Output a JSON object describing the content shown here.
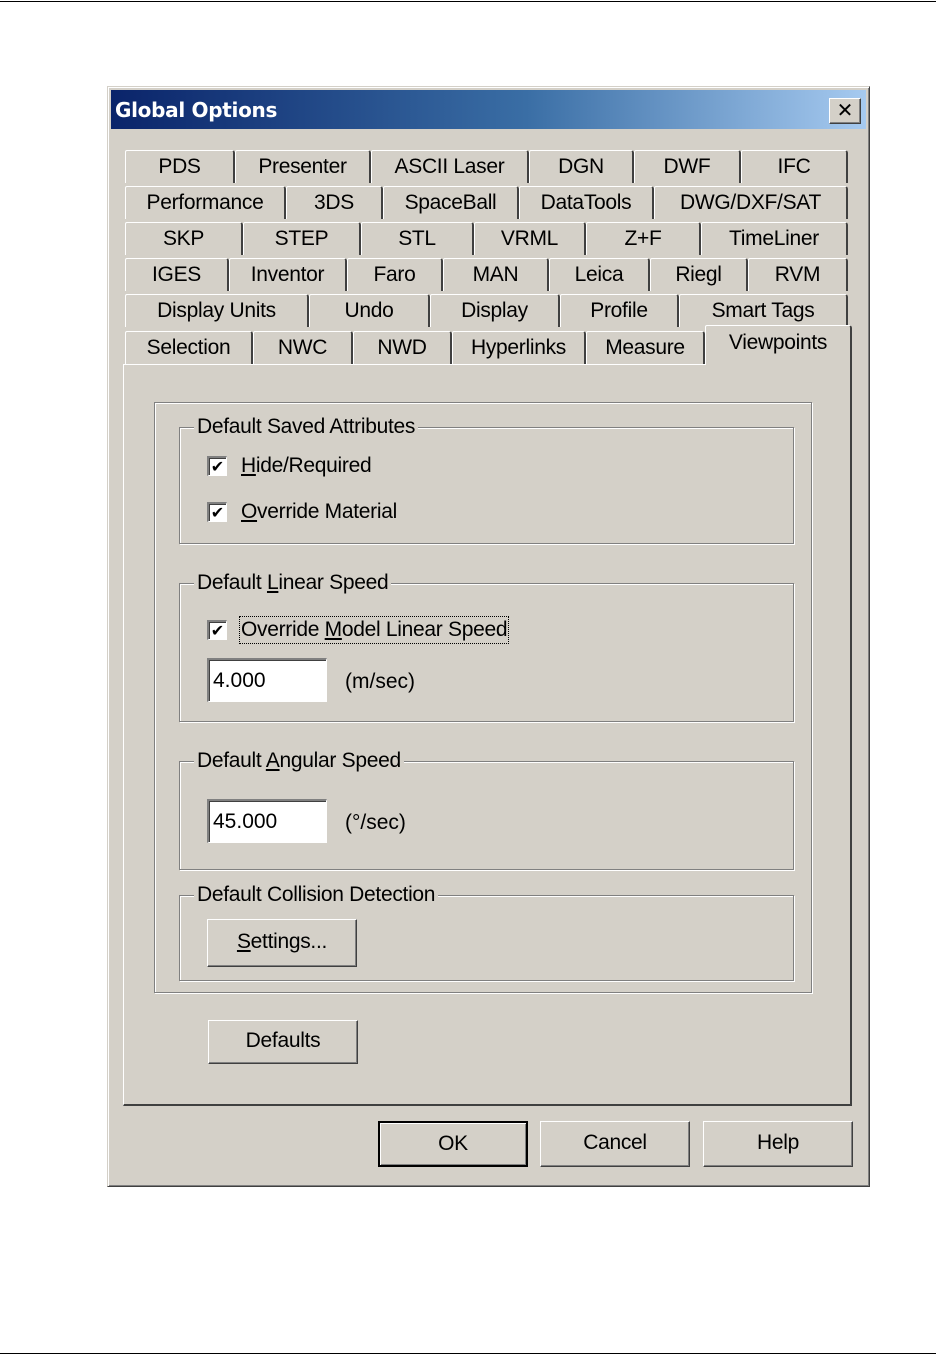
{
  "dialog": {
    "title": "Global Options",
    "close_glyph": "✕"
  },
  "tabs": {
    "row1": [
      "PDS",
      "Presenter",
      "ASCII Laser",
      "DGN",
      "DWF",
      "IFC"
    ],
    "row2": [
      "Performance",
      "3DS",
      "SpaceBall",
      "DataTools",
      "DWG/DXF/SAT"
    ],
    "row3": [
      "SKP",
      "STEP",
      "STL",
      "VRML",
      "Z+F",
      "TimeLiner"
    ],
    "row4": [
      "IGES",
      "Inventor",
      "Faro",
      "MAN",
      "Leica",
      "Riegl",
      "RVM"
    ],
    "row5": [
      "Display Units",
      "Undo",
      "Display",
      "Profile",
      "Smart Tags"
    ],
    "row6": [
      "Selection",
      "NWC",
      "NWD",
      "Hyperlinks",
      "Measure",
      "Viewpoints"
    ],
    "active": "Viewpoints"
  },
  "saved_attributes": {
    "title": "Default Saved Attributes",
    "hide_required": {
      "label_mnemonic": "H",
      "label_rest": "ide/Required",
      "checked": true
    },
    "override_material": {
      "label_mnemonic": "O",
      "label_rest": "verride Material",
      "checked": true
    }
  },
  "linear_speed": {
    "title_pre": "Default ",
    "title_mnemonic": "L",
    "title_post": "inear Speed",
    "override": {
      "label_pre": "Override ",
      "label_mnemonic": "M",
      "label_post": "odel Linear Speed",
      "checked": true
    },
    "value": "4.000",
    "unit": "(m/sec)"
  },
  "angular_speed": {
    "title_pre": "Default ",
    "title_mnemonic": "A",
    "title_post": "ngular Speed",
    "value": "45.000",
    "unit": "(°/sec)"
  },
  "collision": {
    "title": "Default Collision Detection",
    "settings_mnemonic": "S",
    "settings_rest": "ettings..."
  },
  "buttons": {
    "defaults": "Defaults",
    "ok": "OK",
    "cancel": "Cancel",
    "help": "Help"
  },
  "check_glyph": "✔"
}
